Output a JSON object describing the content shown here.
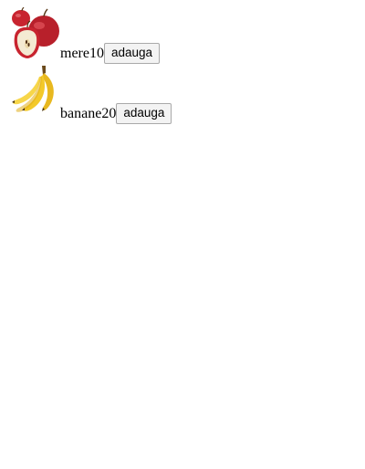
{
  "products": [
    {
      "image_icon": "apple-icon",
      "name": "mere",
      "price": "10",
      "button_label": "adauga"
    },
    {
      "image_icon": "banana-icon",
      "name": "banane",
      "price": "20",
      "button_label": "adauga"
    }
  ],
  "colors": {
    "background": "#ffffff",
    "apple_red": "#c8242f",
    "apple_flesh": "#f4ead2",
    "banana_yellow": "#f3c92a",
    "button_bg": "#f3f3f3",
    "button_border": "#a9a9a9"
  }
}
